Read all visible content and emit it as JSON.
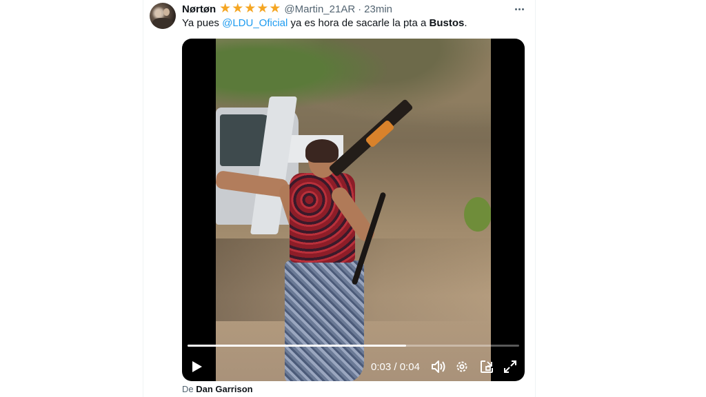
{
  "tweet": {
    "author_name": "Nørtøn",
    "stars": [
      "★",
      "★",
      "★",
      "★",
      "★"
    ],
    "handle": "@Martin_21AR",
    "separator": "·",
    "time": "23min",
    "text_before": "Ya pues ",
    "mention": "@LDU_Oficial",
    "text_after": " ya es hora de sacarle la pta a ",
    "bold_word": "Bustos",
    "text_end": "."
  },
  "video": {
    "time_current": "0:03",
    "time_separator": " / ",
    "time_total": "0:04",
    "progress": 0.66
  },
  "source": {
    "prefix": "De ",
    "name": "Dan Garrison"
  },
  "colors": {
    "mention": "#1d9bf0",
    "star": "#f5a623",
    "muted": "#536471"
  },
  "icons": [
    "more-icon",
    "play-icon",
    "volume-icon",
    "settings-icon",
    "pip-icon",
    "fullscreen-icon"
  ]
}
